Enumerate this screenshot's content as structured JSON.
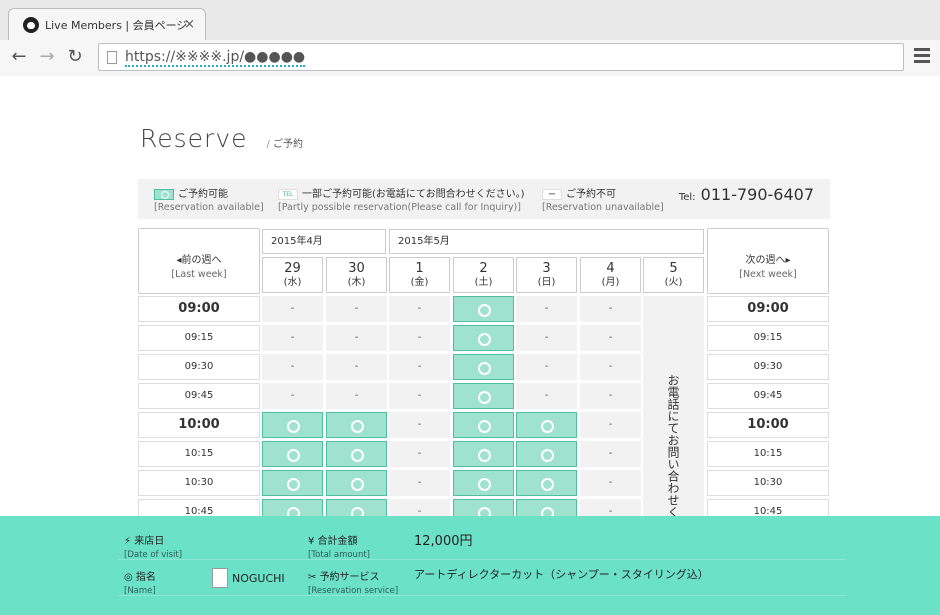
{
  "browser": {
    "tab_title": "Live Members | 会員ページ",
    "close": "×",
    "url": "https://※※※※.jp/●●●●●",
    "back": "←",
    "forward": "→",
    "reload": "↻"
  },
  "page": {
    "title": "Reserve",
    "title_sep": "/",
    "title_sub": "ご予約"
  },
  "legend": {
    "ok": "ご予約可能",
    "ok_sub": "[Reservation available]",
    "tel": "一部ご予約可能(お電話にてお問合わせください。)",
    "tel_sub": "[Partly possible reservation(Please call for Inquiry)]",
    "tel_badge": "TEL",
    "ng": "ご予約不可",
    "ng_sub": "[Reservation unavailable]",
    "ng_badge": "ー",
    "tel_prefix": "Tel:",
    "tel_number": "011-790-6407"
  },
  "nav": {
    "prev": "前の週へ",
    "prev_sub": "[Last week]",
    "next": "次の週へ",
    "next_sub": "[Next week]"
  },
  "months": [
    "2015年4月",
    "2015年5月"
  ],
  "days": [
    {
      "d": "29",
      "w": "(水)"
    },
    {
      "d": "30",
      "w": "(木)"
    },
    {
      "d": "1",
      "w": "(金)"
    },
    {
      "d": "2",
      "w": "(土)"
    },
    {
      "d": "3",
      "w": "(日)"
    },
    {
      "d": "4",
      "w": "(月)"
    },
    {
      "d": "5",
      "w": "(火)"
    }
  ],
  "telcol_text": "お電話にてお問い合わせくださ",
  "times": [
    "09:00",
    "09:15",
    "09:30",
    "09:45",
    "10:00",
    "10:15",
    "10:30",
    "10:45"
  ],
  "grid": [
    [
      "-",
      "-",
      "-",
      "ok",
      "-",
      "-"
    ],
    [
      "-",
      "-",
      "-",
      "ok",
      "-",
      "-"
    ],
    [
      "-",
      "-",
      "-",
      "ok",
      "-",
      "-"
    ],
    [
      "-",
      "-",
      "-",
      "ok",
      "-",
      "-"
    ],
    [
      "ok",
      "ok",
      "-",
      "ok",
      "ok",
      "-"
    ],
    [
      "ok",
      "ok",
      "-",
      "ok",
      "ok",
      "-"
    ],
    [
      "ok",
      "ok",
      "-",
      "ok",
      "ok",
      "-"
    ],
    [
      "ok",
      "ok",
      "-",
      "ok",
      "ok",
      "-"
    ]
  ],
  "footer": {
    "date_label": "来店日",
    "date_sub": "[Date of visit]",
    "total_label": "合計金額",
    "total_sub": "[Total amount]",
    "total_value": "12,000円",
    "name_label": "指名",
    "name_sub": "[Name]",
    "name_value": "NOGUCHI",
    "service_label": "予約サービス",
    "service_sub": "[Reservation service]",
    "service_value": "アートディレクターカット（シャンプー・スタイリング込）"
  }
}
